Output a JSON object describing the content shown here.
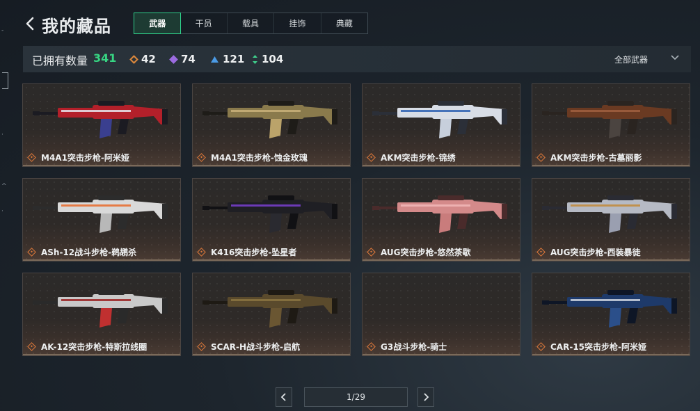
{
  "header": {
    "title": "我的藏品"
  },
  "tabs": [
    {
      "label": "武器",
      "active": true
    },
    {
      "label": "干员",
      "active": false
    },
    {
      "label": "载具",
      "active": false
    },
    {
      "label": "挂饰",
      "active": false
    },
    {
      "label": "典藏",
      "active": false
    }
  ],
  "stats": {
    "owned_label": "已拥有数量",
    "owned_count": "341",
    "counts": [
      {
        "icon": "orange-diamond-icon",
        "color": "#e08a3c",
        "value": "42"
      },
      {
        "icon": "purple-diamond-icon",
        "color": "#9b6be0",
        "value": "74"
      },
      {
        "icon": "blue-triangle-icon",
        "color": "#4b9be6",
        "value": "121"
      },
      {
        "icon": "green-arrows-icon",
        "color": "#3fd08c",
        "value": "104"
      }
    ]
  },
  "filter": {
    "label": "全部武器"
  },
  "items": [
    {
      "name": "M4A1突击步枪-阿米娅",
      "skin": "red"
    },
    {
      "name": "M4A1突击步枪-蚀金玫瑰",
      "skin": "gold"
    },
    {
      "name": "AKM突击步枪-锦绣",
      "skin": "blue"
    },
    {
      "name": "AKM突击步枪-古墓丽影",
      "skin": "wood"
    },
    {
      "name": "ASh-12战斗步枪-鹈鹕杀",
      "skin": "white"
    },
    {
      "name": "K416突击步枪-坠星者",
      "skin": "black"
    },
    {
      "name": "AUG突击步枪-悠然茶歇",
      "skin": "pink"
    },
    {
      "name": "AUG突击步枪-西装暴徒",
      "skin": "silver"
    },
    {
      "name": "AK-12突击步枪-特斯拉线圈",
      "skin": "tesla"
    },
    {
      "name": "SCAR-H战斗步枪-启航",
      "skin": "bronze"
    },
    {
      "name": "G3战斗步枪-骑士",
      "skin": "none"
    },
    {
      "name": "CAR-15突击步枪-阿米娅",
      "skin": "navy"
    }
  ],
  "pagination": {
    "label": "1/29"
  },
  "accent_color": "#2fd08a"
}
